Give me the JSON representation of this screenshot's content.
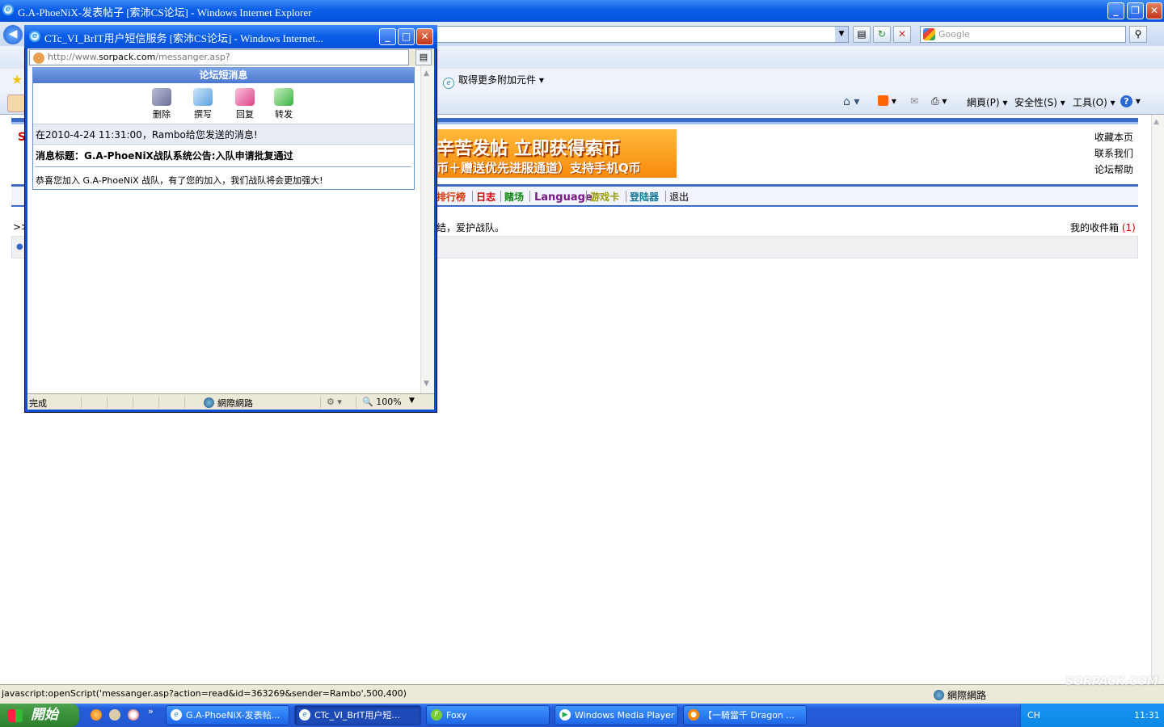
{
  "main_window": {
    "title": "G.A-PhoeNiX-发表帖子 [索沛CS论坛] - Windows Internet Explorer",
    "window_buttons": [
      "minimize-icon",
      "restore-icon",
      "close-icon"
    ],
    "search_placeholder": "Google",
    "addons_label": "取得更多附加元件",
    "command_bar": {
      "page_label": "網頁(P)",
      "safety_label": "安全性(S)",
      "tools_label": "工具(O)"
    }
  },
  "page": {
    "banner": {
      "line1": "辛苦发帖 立即获得索币",
      "line2": "币＋赠送优先进服通道）支持手机Q币"
    },
    "right_links": [
      "收藏本页",
      "联系我们",
      "论坛帮助"
    ],
    "menu": [
      {
        "label": "排行榜",
        "color": "#d4380d"
      },
      {
        "label": "日志",
        "color": "#cc0000"
      },
      {
        "label": "赌场",
        "color": "#118811"
      },
      {
        "label": "Language",
        "color": "#7a1a8a"
      },
      {
        "label": "游戏卡",
        "color": "#999900"
      },
      {
        "label": "登陆器",
        "color": "#117799"
      },
      {
        "label": "退出",
        "color": "#000000"
      }
    ],
    "notice_text": "团结，爱护战队。",
    "notice_fragment": "结，爱护战队。",
    "inbox_label": "我的收件箱",
    "inbox_count": "(1)",
    "left_fragment": ">>"
  },
  "status_bar": {
    "text": "javascript:openScript('messanger.asp?action=read&id=363269&sender=Rambo',500,400)",
    "zone": "網際網路"
  },
  "popup": {
    "title": "CTc_VI_BrIT用户短信服务 [索沛CS论坛] - Windows Internet...",
    "url_prefix": "http://www.",
    "url_domain": "sorpack.com",
    "url_path": "/messanger.asp?action=read&id=363269&sender=Rambo",
    "panel_title": "论坛短消息",
    "toolbar": [
      {
        "label": "删除",
        "icon": "delete-icon",
        "color": "#8a8fb0"
      },
      {
        "label": "撰写",
        "icon": "compose-icon",
        "color": "#5aa0e0"
      },
      {
        "label": "回复",
        "icon": "reply-icon",
        "color": "#e0408a"
      },
      {
        "label": "转发",
        "icon": "forward-icon",
        "color": "#3cb043"
      }
    ],
    "message_header": "在2010-4-24 11:31:00，Rambo给您发送的消息!",
    "message_subject": "消息标题：G.A-PhoeNiX战队系统公告:入队申请批复通过",
    "message_body": "恭喜您加入 G.A-PhoeNiX 战队，有了您的加入，我们战队将会更加强大!",
    "status": {
      "done": "完成",
      "zone": "網際網路",
      "zoom": "100%"
    }
  },
  "taskbar": {
    "start_label": "開始",
    "tasks": [
      {
        "label": "G.A-PhoeNiX-发表帖...",
        "active": false
      },
      {
        "label": "CTc_VI_BrIT用户短...",
        "active": true
      },
      {
        "label": "Foxy",
        "active": false
      },
      {
        "label": "Windows Media Player",
        "active": false
      },
      {
        "label": "【一騎當千 Dragon ...",
        "active": false
      }
    ],
    "tray": {
      "lang": "CH",
      "clock": "11:31",
      "zoom": "100%"
    }
  },
  "watermark": "SORPACK.COM"
}
